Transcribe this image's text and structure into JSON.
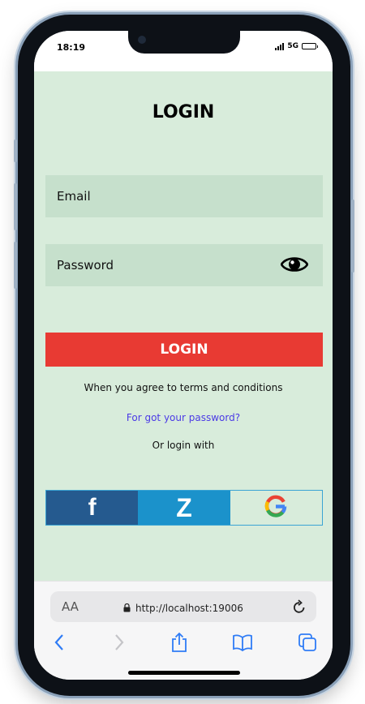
{
  "status_bar": {
    "time": "18:19",
    "network": "5G"
  },
  "login": {
    "title": "LOGIN",
    "email_placeholder": "Email",
    "password_placeholder": "Password",
    "button_label": "LOGIN",
    "terms_text": "When you agree to terms and conditions",
    "forgot_password": "For got your password?",
    "or_login_with": "Or login with"
  },
  "social": {
    "facebook_glyph": "f",
    "zalo_glyph": "Z",
    "icons": [
      "facebook-icon",
      "zalo-icon",
      "google-icon"
    ]
  },
  "browser": {
    "text_size_label": "AA",
    "url": "http://localhost:19006",
    "toolbar_icons": [
      "back-icon",
      "forward-icon",
      "share-icon",
      "bookmarks-icon",
      "tabs-icon"
    ]
  },
  "colors": {
    "background": "#d8ecdb",
    "field": "#c6e0cc",
    "login_button": "#e83a33",
    "facebook": "#255a8f",
    "zalo": "#1b92cb",
    "link": "#4b3ae6"
  }
}
